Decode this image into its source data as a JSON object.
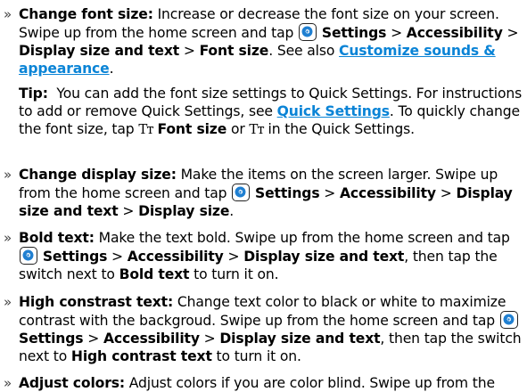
{
  "items": [
    {
      "title": "Change font size:",
      "text1": " Increase or decrease the font size on your screen. Swipe up from the home screen and tap ",
      "path1": "Settings",
      "sep": " > ",
      "path2": "Accessibility",
      "path3": "Display size and text",
      "path4": "Font size",
      "text2": ". See also ",
      "link": "Customize sounds & appearance",
      "text3": "."
    },
    {
      "tip_label": "Tip:",
      "tip_text1": "  You can add the font size settings to Quick Settings. For instructions to add or remove Quick Settings, see ",
      "tip_link": "Quick Settings",
      "tip_text2": ". To quickly change the font size, tap ",
      "tip_tt": "Tт",
      "tip_fontsize": "Font size",
      "tip_text3": " or ",
      "tip_tt2": "Tт",
      "tip_text4": " in the Quick Settings."
    },
    {
      "title": "Change display size:",
      "text1": " Make the items on the screen larger. Swipe up from the home screen and tap ",
      "path1": "Settings",
      "path2": "Accessibility",
      "path3": "Display size and text",
      "path4": "Display size",
      "text2": "."
    },
    {
      "title": "Bold text:",
      "text1": " Make the text bold. Swipe up from the home screen and tap ",
      "path1": "Settings",
      "path2": "Accessibility",
      "path3": "Display size and text",
      "text2": ", then tap the switch next to ",
      "target": "Bold text",
      "text3": " to turn it on."
    },
    {
      "title": "High constrast text:",
      "text1": " Change text color to black or white to maximize contrast with the backgroud. Swipe up from the home screen and tap ",
      "path1": "Settings",
      "path2": "Accessibility",
      "path3": "Display size and text",
      "text2": ", then tap the switch next to ",
      "target": "High contrast text",
      "text3": " to turn it on."
    },
    {
      "title": "Adjust colors:",
      "text1": " Adjust colors if you are color blind. Swipe up from the"
    }
  ],
  "bullet_char": "»",
  "icons": {
    "settings": "settings-gear-icon"
  },
  "colors": {
    "link": "#0b84d6",
    "gear_fill": "#1f7fd1"
  }
}
